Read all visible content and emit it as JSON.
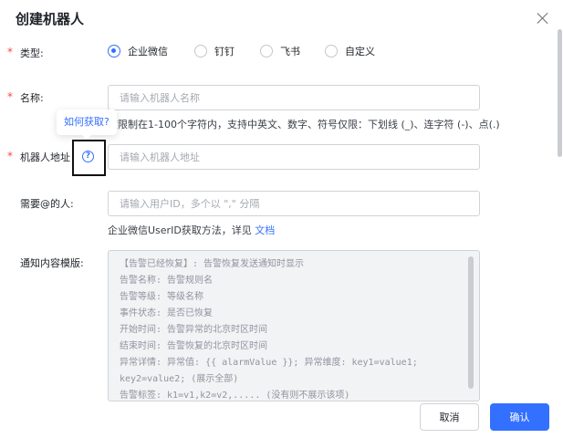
{
  "dialog": {
    "title": "创建机器人"
  },
  "form": {
    "type": {
      "required_mark": "*",
      "label": "类型:",
      "options": [
        {
          "label": "企业微信",
          "checked": true
        },
        {
          "label": "钉钉",
          "checked": false
        },
        {
          "label": "飞书",
          "checked": false
        },
        {
          "label": "自定义",
          "checked": false
        }
      ]
    },
    "name": {
      "required_mark": "*",
      "label": "名称:",
      "placeholder": "请输入机器人名称",
      "hint": "度限制在1-100个字符内，支持中英文、数字、符号仅限：下划线 (_)、连字符 (-)、点(.)"
    },
    "tooltip": {
      "text": "如何获取?"
    },
    "address": {
      "required_mark": "*",
      "label": "机器人地址",
      "help_icon_glyph": "?",
      "placeholder": "请输入机器人地址"
    },
    "mentions": {
      "label": "需要@的人:",
      "placeholder": "请输入用户ID，多个以 \",\" 分隔",
      "hint_prefix": "企业微信UserID获取方法，详见",
      "hint_link": "文档"
    },
    "template": {
      "label": "通知内容模版:",
      "lines": [
        "【告警已经恢复】: 告警恢复发送通知时显示",
        "告警名称: 告警规则名",
        "告警等级: 等级名称",
        "事件状态: 是否已恢复",
        "开始时间: 告警异常的北京时区时间",
        "结束时间: 告警恢复的北京时区时间",
        "异常详情: 异常值: {{ alarmValue }}; 异常维度: key1=value1;",
        "key2=value2; (展示全部)",
        "告警标签: k1=v1,k2=v2,..... (没有则不展示该项)"
      ]
    }
  },
  "footer": {
    "cancel_label": "取消",
    "confirm_label": "确认"
  },
  "colors": {
    "primary": "#3370ff",
    "required": "#f54a45"
  }
}
